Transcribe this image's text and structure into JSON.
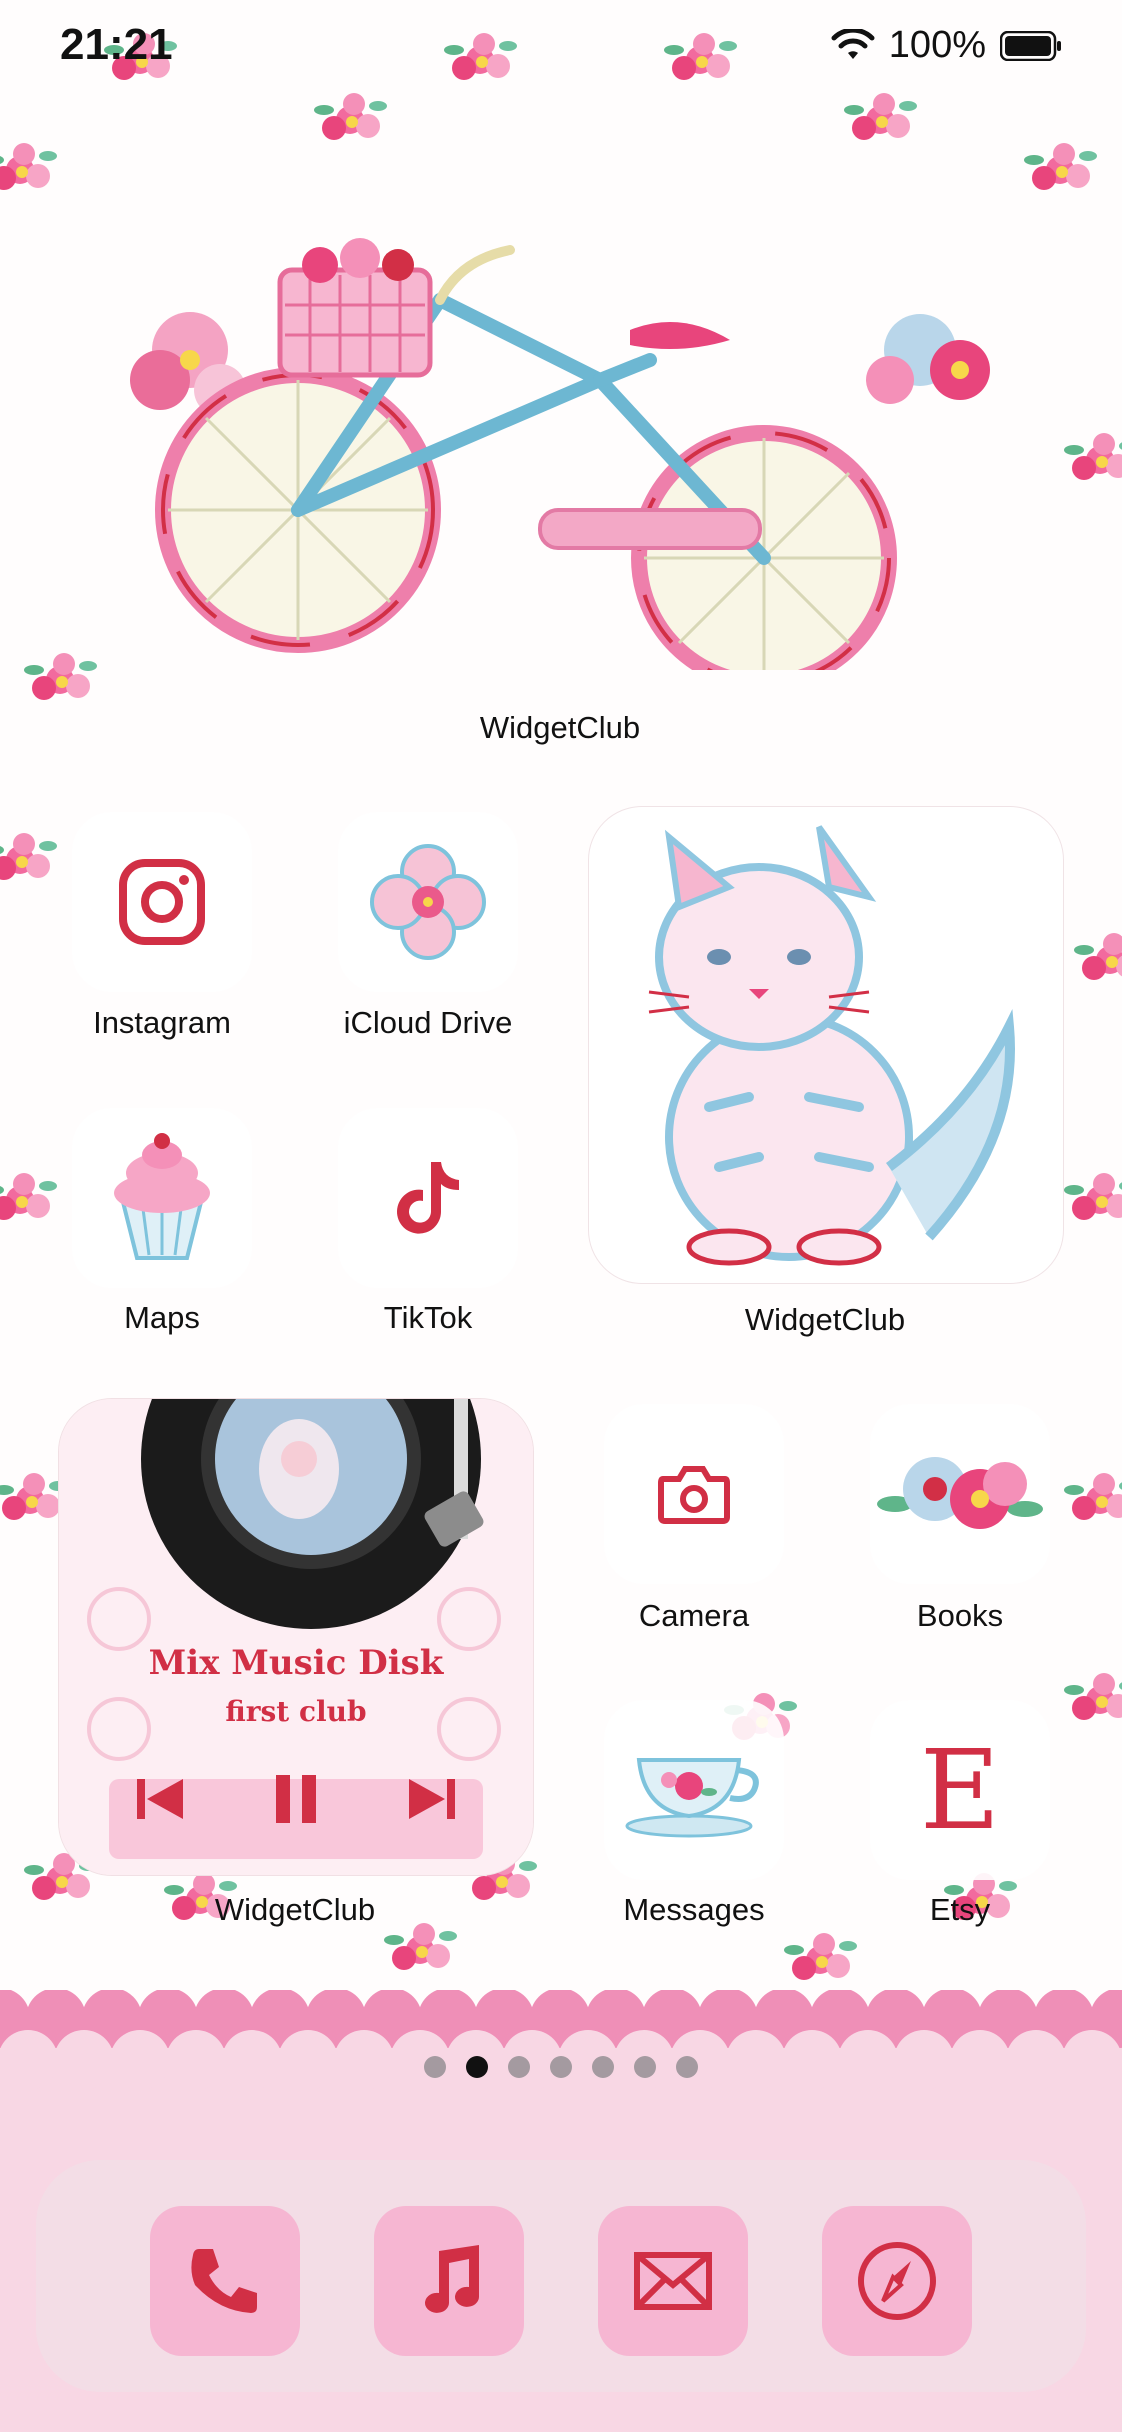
{
  "status_bar": {
    "time": "21:21",
    "battery_percent": "100%"
  },
  "widgets": {
    "bike": {
      "label": "WidgetClub"
    },
    "cat": {
      "label": "WidgetClub"
    },
    "music": {
      "label": "WidgetClub",
      "title": "Mix Music Disk",
      "subtitle": "first club"
    }
  },
  "apps": [
    {
      "label": "Instagram",
      "icon": "instagram-icon"
    },
    {
      "label": "iCloud Drive",
      "icon": "clover-icon"
    },
    {
      "label": "Maps",
      "icon": "cupcake-icon"
    },
    {
      "label": "TikTok",
      "icon": "tiktok-icon"
    },
    {
      "label": "Camera",
      "icon": "camera-icon"
    },
    {
      "label": "Books",
      "icon": "flowers-icon"
    },
    {
      "label": "Messages",
      "icon": "teacup-icon"
    },
    {
      "label": "Etsy",
      "icon": "etsy-icon"
    }
  ],
  "page_indicator": {
    "count": 7,
    "active_index": 1
  },
  "dock": [
    {
      "icon": "phone-icon"
    },
    {
      "icon": "music-note-icon"
    },
    {
      "icon": "mail-icon"
    },
    {
      "icon": "compass-icon"
    }
  ],
  "colors": {
    "accent_red": "#d12f45",
    "dock_icon_pink": "#f6b6d2",
    "band_pink": "#f8d7e4",
    "scallop_pink": "#ef8fb7"
  }
}
